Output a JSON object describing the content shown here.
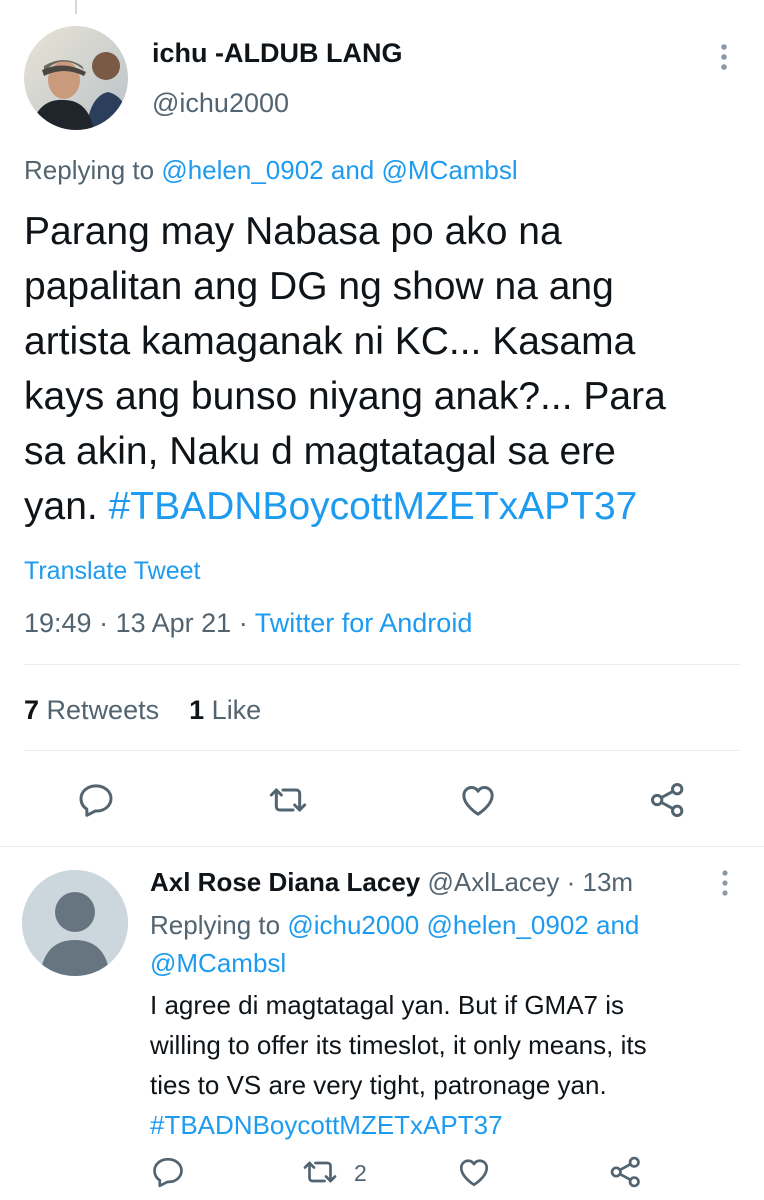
{
  "tweet": {
    "author_name": "ichu -ALDUB LANG",
    "author_handle": "@ichu2000",
    "replying_prefix": "Replying to",
    "replying_user1": "@helen_0902",
    "replying_and": "and",
    "replying_user2": "@MCambsl",
    "text_lines": [
      "Parang may Nabasa po ako na",
      "papalitan ang DG ng show na ang",
      "artista kamaganak ni KC... Kasama",
      "kays ang bunso  niyang anak?... Para",
      "sa akin, Naku d magtatagal sa ere"
    ],
    "text_last_prefix": "yan.",
    "hashtag": "#TBADNBoycottMZETxAPT37",
    "translate_label": "Translate Tweet",
    "time": "19:49",
    "date": "13 Apr 21",
    "meta_sep": "·",
    "source": "Twitter for Android",
    "retweet_count": "7",
    "retweet_label": "Retweets",
    "like_count": "1",
    "like_label": "Like"
  },
  "reply": {
    "author_name": "Axl Rose Diana Lacey",
    "author_handle": "@AxlLacey",
    "sep": "·",
    "time_ago": "13m",
    "replying_prefix": "Replying to",
    "replying_users": "@ichu2000 @helen_0902",
    "replying_and": "and",
    "replying_user_last": "@MCambsl",
    "text_lines": [
      "I agree di magtatagal yan. But if GMA7 is",
      "willing to offer its timeslot, it only means, its",
      "ties to VS are very tight, patronage yan."
    ],
    "hashtag": "#TBADNBoycottMZETxAPT37",
    "retweet_count": "2"
  },
  "colors": {
    "accent": "#1d9bf0",
    "secondary_text": "#536471",
    "primary_text": "#0f1419",
    "divider": "#e6ecf0"
  },
  "icons": {
    "reply": "reply-icon",
    "retweet": "retweet-icon",
    "like": "heart-icon",
    "share": "share-icon",
    "more": "more-vertical-icon"
  }
}
